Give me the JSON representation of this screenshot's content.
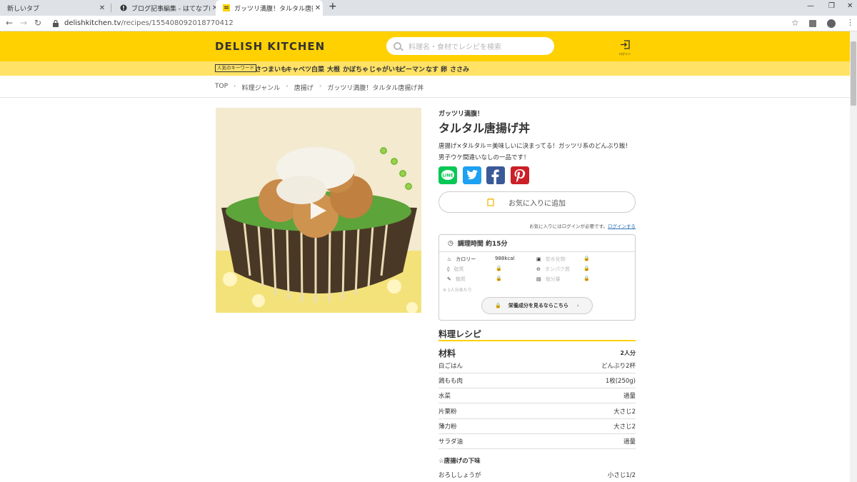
{
  "browser": {
    "tabs": [
      {
        "title": "新しいタブ"
      },
      {
        "title": "ブログ記事編集 - はてなブログ"
      },
      {
        "title": "ガッツリ満腹！タルタル唐揚げ丼"
      }
    ],
    "url_host": "delishkitchen.tv",
    "url_path": "/recipes/155408092018770412"
  },
  "site": {
    "logo": "DELISH KITCHEN",
    "search_placeholder": "料理名・食材でレシピを検索",
    "login_label": "ログイン",
    "keyword_label": "人気のキーワード",
    "keywords": [
      "さつまいも",
      "キャベツ",
      "白菜",
      "大根",
      "かぼちゃ",
      "じゃがいも",
      "ピーマン",
      "なす",
      "卵",
      "ささみ"
    ]
  },
  "breadcrumb": [
    "TOP",
    "料理ジャンル",
    "唐揚げ",
    "ガッツリ満腹！タルタル唐揚げ丼"
  ],
  "recipe": {
    "subtitle": "ガッツリ満腹！",
    "title": "タルタル唐揚げ丼",
    "description": "唐揚げ×タルタル＝美味しいに決まってる！ガッツリ系のどんぶり飯！男子ウケ間違いなしの一品です！",
    "fav_button": "お気に入りに追加",
    "fav_note": "お気に入りにはログインが必要です。",
    "fav_login_link": "ログインする",
    "cook_time": "調理時間 約15分",
    "nutrition": {
      "calorie_label": "カロリー",
      "calorie_value": "988kcal",
      "labels": [
        "脂質",
        "糖質",
        "炭水化物",
        "タンパク質",
        "塩分量"
      ],
      "per": "※ 1人分あたり",
      "button": "栄養成分を見るならこちら"
    },
    "section_title": "料理レシピ",
    "ingredients_title": "材料",
    "servings": "2人分",
    "ingredients": [
      {
        "name": "白ごはん",
        "amount": "どんぶり2杯"
      },
      {
        "name": "鶏もも肉",
        "amount": "1枚(250g)"
      },
      {
        "name": "水菜",
        "amount": "適量"
      },
      {
        "name": "片栗粉",
        "amount": "大さじ2"
      },
      {
        "name": "薄力粉",
        "amount": "大さじ2"
      },
      {
        "name": "サラダ油",
        "amount": "適量"
      }
    ],
    "sub_section": "☆唐揚げの下味",
    "sub_ingredients": [
      {
        "name": "おろししょうが",
        "amount": "小さじ1/2"
      }
    ]
  },
  "colors": {
    "brand": "#ffd100",
    "line": "#06c755",
    "twitter": "#1da1f2",
    "facebook": "#3b5998",
    "pinterest": "#cb2027"
  }
}
